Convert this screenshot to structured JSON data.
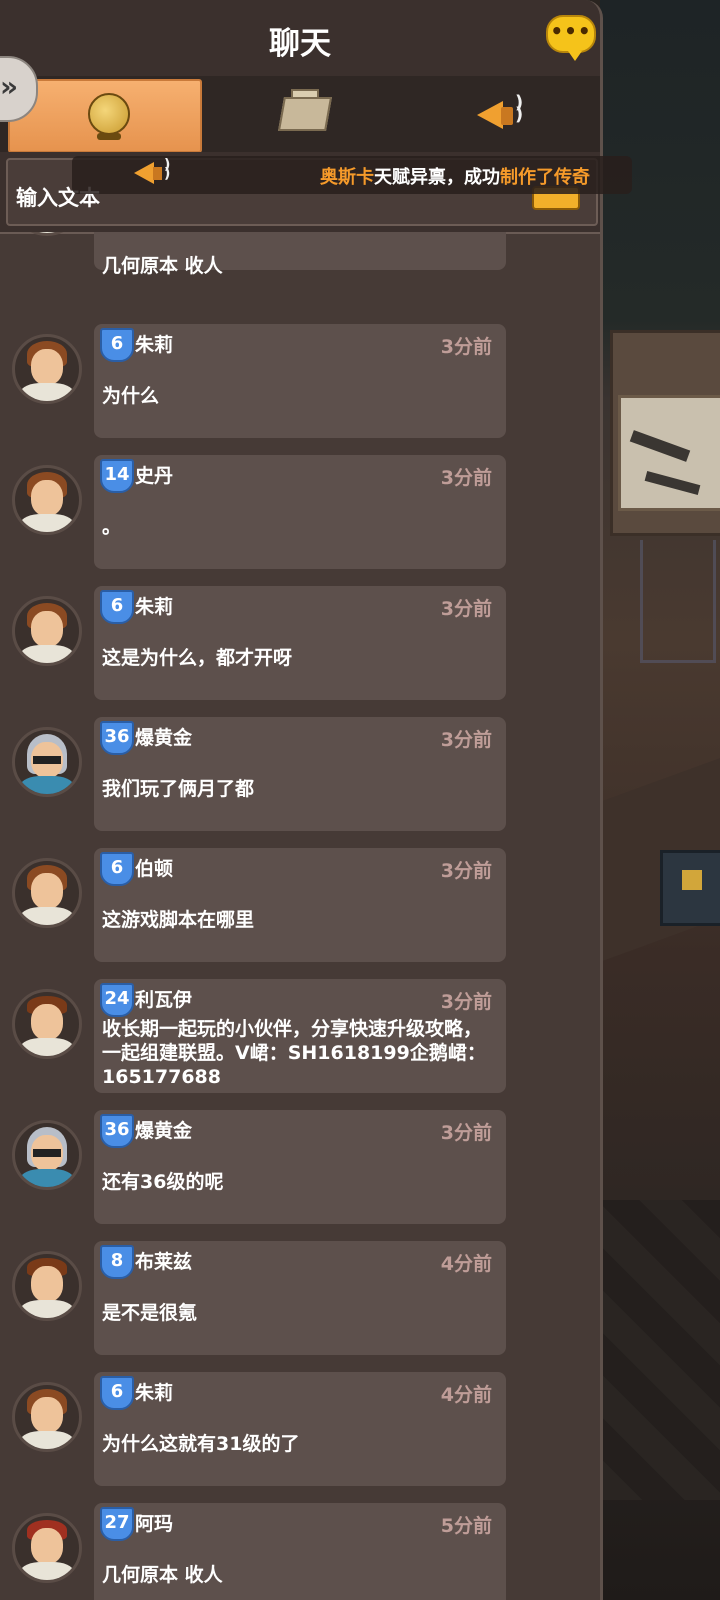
{
  "header": {
    "title": "聊天"
  },
  "input": {
    "label": "输入文本"
  },
  "announcement": {
    "name": "奥斯卡",
    "text_before": "天赋异禀，成功",
    "verb": "制作了",
    "item": "传奇"
  },
  "top_partial_message": {
    "text": "几何原本 收人"
  },
  "messages": [
    {
      "level": "6",
      "name": "朱莉",
      "time": "3分前",
      "text": "为什么",
      "avatar": "girl"
    },
    {
      "level": "14",
      "name": "史丹",
      "time": "3分前",
      "text": "。",
      "avatar": "girl"
    },
    {
      "level": "6",
      "name": "朱莉",
      "time": "3分前",
      "text": "这是为什么，都才开呀",
      "avatar": "girl"
    },
    {
      "level": "36",
      "name": "爆黄金",
      "time": "3分前",
      "text": "我们玩了俩月了都",
      "avatar": "silver"
    },
    {
      "level": "6",
      "name": "伯顿",
      "time": "3分前",
      "text": "这游戏脚本在哪里",
      "avatar": "girl"
    },
    {
      "level": "24",
      "name": "利瓦伊",
      "time": "3分前",
      "text": "收长期一起玩的小伙伴，分享快速升级攻略，一起组建联盟。V峮：SH1618199企鹅峮：165177688",
      "avatar": "male"
    },
    {
      "level": "36",
      "name": "爆黄金",
      "time": "3分前",
      "text": "还有36级的呢",
      "avatar": "silver"
    },
    {
      "level": "8",
      "name": "布莱兹",
      "time": "4分前",
      "text": "是不是很氪",
      "avatar": "male"
    },
    {
      "level": "6",
      "name": "朱莉",
      "time": "4分前",
      "text": "为什么这就有31级的了",
      "avatar": "girl"
    },
    {
      "level": "27",
      "name": "阿玛",
      "time": "5分前",
      "text": "几何原本 收人",
      "avatar": "red"
    }
  ],
  "icons": [
    "chat-icon",
    "globe-icon",
    "guild-icon",
    "horn-icon",
    "send-icon",
    "collapse-icon"
  ],
  "colors": {
    "panel": "#463a36",
    "bubble": "#5d504c",
    "accent_tab": "#f0a060",
    "level_badge": "#4a8ee6",
    "time_text": "#bf9d98",
    "highlight": "#f59a2a"
  }
}
